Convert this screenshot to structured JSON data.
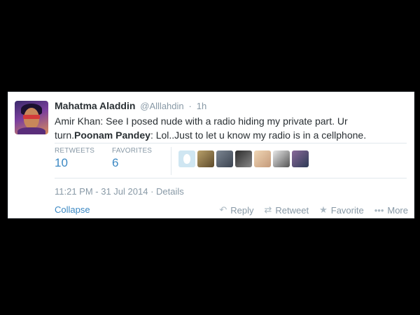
{
  "tweet": {
    "author_name": "Mahatma Aladdin",
    "handle": "@Alllahdin",
    "separator": "·",
    "age": "1h",
    "text_part1": "Amir Khan: See I posed nude with a radio hiding my private part. Ur turn.",
    "text_bold": "Poonam Pandey",
    "text_part2": ": Lol..Just to let u know my radio is in a cellphone."
  },
  "stats": {
    "retweets_label": "RETWEETS",
    "retweets_count": "10",
    "favorites_label": "FAVORITES",
    "favorites_count": "6"
  },
  "favoriter_avatars": [
    "egg-avatar",
    "user-avatar",
    "user-avatar",
    "user-avatar",
    "user-avatar",
    "user-avatar",
    "user-avatar"
  ],
  "timestamp": "11:21 PM - 31 Jul 2014",
  "details_label": "Details",
  "collapse_label": "Collapse",
  "actions": {
    "reply": "Reply",
    "retweet": "Retweet",
    "favorite": "Favorite",
    "more": "More"
  },
  "colors": {
    "link": "#3b88c3",
    "muted": "#8899a6",
    "text": "#292f33"
  }
}
